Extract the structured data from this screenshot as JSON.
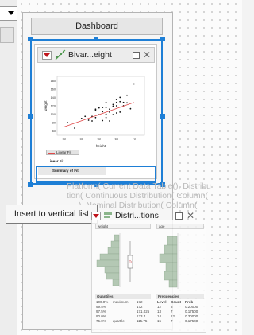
{
  "dashboard": {
    "title": "Dashboard"
  },
  "bivariate": {
    "title": "Bivar...eight",
    "plot": {
      "xlabel": "height",
      "ylabel": "weight",
      "x_ticks": [
        "50",
        "55",
        "60",
        "65",
        "70"
      ],
      "y_ticks": [
        "180",
        "160",
        "140",
        "120",
        "100",
        "80",
        "60"
      ],
      "points": [
        [
          51,
          80
        ],
        [
          53,
          67
        ],
        [
          55,
          90
        ],
        [
          56,
          95
        ],
        [
          57,
          86
        ],
        [
          58,
          95
        ],
        [
          58,
          84
        ],
        [
          59,
          92
        ],
        [
          59,
          110
        ],
        [
          59,
          112
        ],
        [
          60,
          99
        ],
        [
          60,
          115
        ],
        [
          61,
          116
        ],
        [
          61,
          106
        ],
        [
          61,
          85
        ],
        [
          62,
          92
        ],
        [
          62,
          100
        ],
        [
          62,
          116
        ],
        [
          62,
          128
        ],
        [
          63,
          84
        ],
        [
          63,
          105
        ],
        [
          63,
          112
        ],
        [
          64,
          119
        ],
        [
          64,
          123
        ],
        [
          64,
          99
        ],
        [
          65,
          103
        ],
        [
          65,
          120
        ],
        [
          65,
          128
        ],
        [
          65,
          135
        ],
        [
          66,
          105
        ],
        [
          66,
          130
        ],
        [
          66,
          140
        ],
        [
          67,
          120
        ],
        [
          67,
          128
        ],
        [
          68,
          127
        ],
        [
          68,
          145
        ],
        [
          69,
          113
        ],
        [
          70,
          172
        ]
      ],
      "fit_line": [
        [
          50,
          70
        ],
        [
          70,
          128
        ]
      ]
    },
    "legend_label": "Linear Fit",
    "linear_fit_header": "Linear Fit",
    "summary_label": "Summary of Fit"
  },
  "ghost_script": {
    "line1": "Platform( Current Data Table(), Distribu",
    "line2": "tion( Continuous Distribution( Column(",
    "line3": "), Nominal Distribution( Column("
  },
  "tooltip": {
    "text": "Insert to vertical list"
  },
  "distributions": {
    "title": "Distri...tions",
    "col1_header": "weight",
    "col2_header": "age",
    "quantiles_title": "Quantiles",
    "quantiles": [
      [
        "100.0%",
        "maximum",
        "172"
      ],
      [
        "99.5%",
        "",
        "172"
      ],
      [
        "97.5%",
        "",
        "171.025"
      ],
      [
        "90.0%",
        "",
        "133.4"
      ],
      [
        "75.0%",
        "quartile",
        "115.75"
      ]
    ],
    "frequencies_title": "Frequencies",
    "freq_headers": [
      "Level",
      "Count",
      "Prob"
    ],
    "frequencies": [
      [
        "12",
        "8",
        "0.20000"
      ],
      [
        "13",
        "7",
        "0.17500"
      ],
      [
        "14",
        "12",
        "0.30000"
      ],
      [
        "15",
        "7",
        "0.17500"
      ]
    ]
  },
  "colors": {
    "accent": "#1e7fd6",
    "fit_line": "#e04a4a",
    "hist_fill": "#a9c1a9"
  }
}
